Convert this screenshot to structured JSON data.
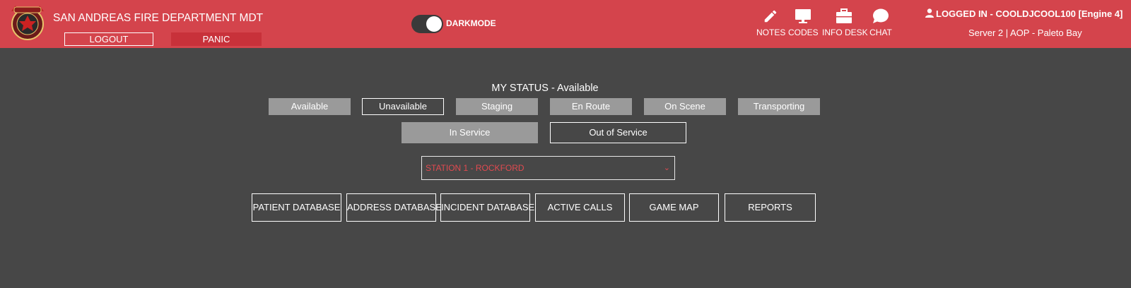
{
  "header": {
    "title": "SAN ANDREAS FIRE DEPARTMENT MDT",
    "logout_label": "LOGOUT",
    "panic_label": "PANIC",
    "darkmode_label": "DARKMODE",
    "nav": [
      {
        "label": "NOTES",
        "icon": "pencil-icon"
      },
      {
        "label": "CODES",
        "icon": "monitor-icon"
      },
      {
        "label": "INFO DESK",
        "icon": "briefcase-icon"
      },
      {
        "label": "CHAT",
        "icon": "chat-bubble-icon"
      }
    ],
    "user_text": "LOGGED IN - COOLDJCOOL100 [Engine 4]",
    "server_text": "Server 2 | AOP - Paleto Bay"
  },
  "status": {
    "heading": "MY STATUS - Available",
    "buttons": [
      "Available",
      "Unavailable",
      "Staging",
      "En Route",
      "On Scene",
      "Transporting"
    ],
    "service_buttons": [
      "In Service",
      "Out of Service"
    ]
  },
  "station": {
    "selected": "STATION 1 - ROCKFORD"
  },
  "actions": [
    "PATIENT DATABASE",
    "ADDRESS DATABASE",
    "INCIDENT DATABASE",
    "ACTIVE CALLS",
    "GAME MAP",
    "REPORTS"
  ],
  "colors": {
    "header_bg": "#d4444c",
    "panic_bg": "#c8313a",
    "page_bg": "#474747",
    "status_fill": "#9a9a9a",
    "station_text": "#e24a50"
  }
}
